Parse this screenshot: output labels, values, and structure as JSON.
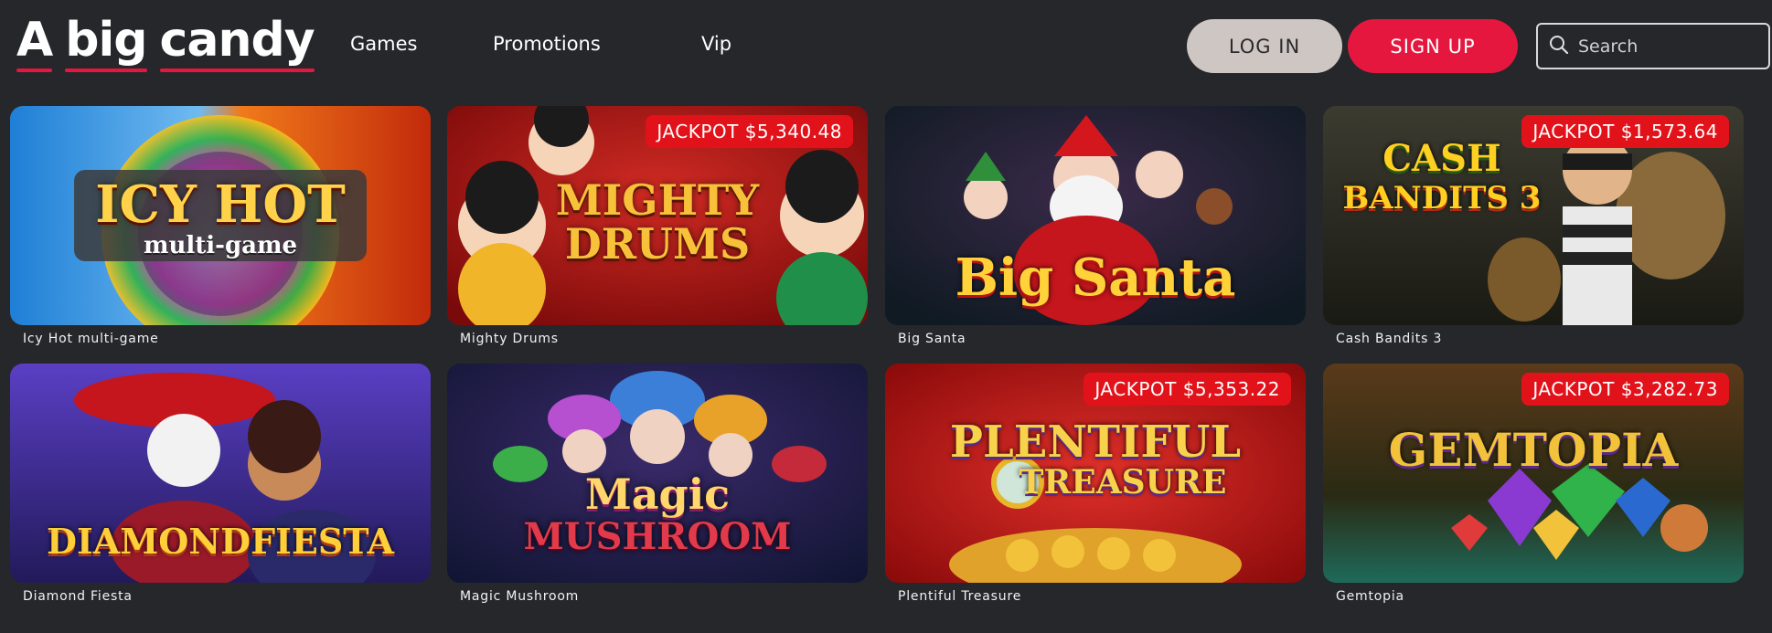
{
  "brand": {
    "logo_word1": "A",
    "logo_word2": "big",
    "logo_word3": "candy",
    "accent_color": "#e5173f"
  },
  "nav": {
    "items": [
      {
        "label": "Games"
      },
      {
        "label": "Promotions"
      },
      {
        "label": "Vip"
      }
    ]
  },
  "auth": {
    "login_label": "LOG IN",
    "signup_label": "SIGN UP"
  },
  "search": {
    "placeholder": "Search",
    "icon": "search-icon"
  },
  "games": [
    {
      "name": "Icy Hot multi-game",
      "art_line1": "ICY HOT",
      "art_line2": "multi-game",
      "jackpot": null
    },
    {
      "name": "Mighty Drums",
      "art_line1": "MIGHTY",
      "art_line2": "DRUMS",
      "jackpot": "JACKPOT $5,340.48"
    },
    {
      "name": "Big Santa",
      "art_line1": "Big Santa",
      "art_line2": "",
      "jackpot": null
    },
    {
      "name": "Cash Bandits 3",
      "art_line1": "CASH",
      "art_line2": "BANDITS 3",
      "jackpot": "JACKPOT $1,573.64"
    },
    {
      "name": "Diamond Fiesta",
      "art_line1": "DIAMONDFIESTA",
      "art_line2": "",
      "jackpot": null
    },
    {
      "name": "Magic Mushroom",
      "art_line1": "Magic",
      "art_line2": "MUSHROOM",
      "jackpot": null
    },
    {
      "name": "Plentiful Treasure",
      "art_line1": "PLENTIFUL",
      "art_line2": "TREASURE",
      "jackpot": "JACKPOT $5,353.22"
    },
    {
      "name": "Gemtopia",
      "art_line1": "GEMTOPIA",
      "art_line2": "",
      "jackpot": "JACKPOT $3,282.73"
    }
  ],
  "colors": {
    "background": "#25272b",
    "jackpot_badge": "#e2121b",
    "login_button": "#cec6c3",
    "signup_button": "#e5173f"
  }
}
